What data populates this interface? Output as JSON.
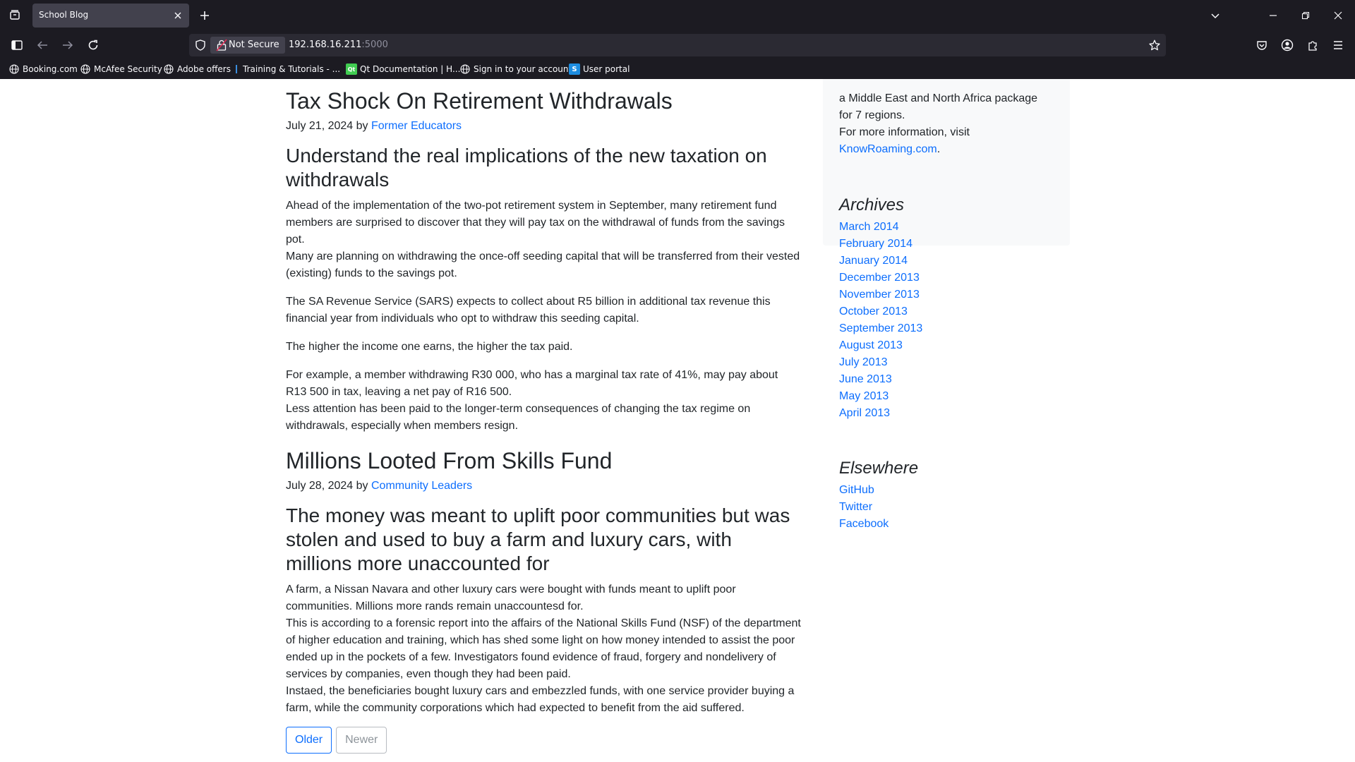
{
  "browser": {
    "tab_title": "School Blog",
    "not_secure_label": "Not Secure",
    "url_host": "192.168.16.211",
    "url_port": ":5000",
    "bookmarks": [
      {
        "label": "Booking.com",
        "icon": "globe-icon"
      },
      {
        "label": "McAfee Security",
        "icon": "globe-icon"
      },
      {
        "label": "Adobe offers",
        "icon": "globe-icon"
      },
      {
        "label": "Training & Tutorials - ...",
        "icon": "training-icon"
      },
      {
        "label": "Qt Documentation | H...",
        "icon": "qt-icon"
      },
      {
        "label": "Sign in to your account",
        "icon": "globe-icon"
      },
      {
        "label": "User portal",
        "icon": "s-icon"
      }
    ],
    "qt_badge": "Qt",
    "s_badge": "S"
  },
  "posts": [
    {
      "title": "Tax Shock On Retirement Withdrawals",
      "date": "July 21, 2024",
      "by": "by",
      "author": "Former Educators",
      "subtitle": "Understand the real implications of the new taxation on withdrawals",
      "paragraphs": [
        "Ahead of the implementation of the two-pot retirement system in September, many retirement fund members are surprised to discover that they will pay tax on the withdrawal of funds from the savings pot.",
        "Many are planning on withdrawing the once-off seeding capital that will be transferred from their vested (existing) funds to the savings pot.",
        "The SA Revenue Service (SARS) expects to collect about R5 billion in additional tax revenue this financial year from individuals who opt to withdraw this seeding capital.",
        "The higher the income one earns, the higher the tax paid.",
        "For example, a member withdrawing R30 000, who has a marginal tax rate of 41%, may pay about R13 500 in tax, leaving a net pay of R16 500.",
        "Less attention has been paid to the longer-term consequences of changing the tax regime on withdrawals, especially when members resign."
      ]
    },
    {
      "title": "Millions Looted From Skills Fund",
      "date": "July 28, 2024",
      "by": "by",
      "author": "Community Leaders",
      "subtitle": "The money was meant to uplift poor communities but was stolen and used to buy a farm and luxury cars, with millions more unaccounted for",
      "paragraphs": [
        "A farm, a Nissan Navara and other luxury cars were bought with funds meant to uplift poor communities. Millions more rands remain unaccountesd for.",
        "This is according to a forensic report into the affairs of the National Skills Fund (NSF) of the department of higher education and training, which has shed some light on how money intended to assist the poor ended up in the pockets of a few. Investigators found evidence of fraud, forgery and nondelivery of services by companies, even though they had been paid.",
        "Instaed, the beneficiaries bought luxury cars and embezzled funds, with one service provider buying a farm, while the community corporations which had expected to benefit from the aid suffered."
      ]
    }
  ],
  "pager": {
    "older": "Older",
    "newer": "Newer"
  },
  "sidebar": {
    "about_line1": "a Middle East and North Africa package",
    "about_line2": "for 7 regions.",
    "about_line3": "For more information, visit",
    "about_link": "KnowRoaming.com",
    "about_period": ".",
    "archives_heading": "Archives",
    "archives": [
      "March 2014",
      "February 2014",
      "January 2014",
      "December 2013",
      "November 2013",
      "October 2013",
      "September 2013",
      "August 2013",
      "July 2013",
      "June 2013",
      "May 2013",
      "April 2013"
    ],
    "elsewhere_heading": "Elsewhere",
    "elsewhere": [
      "GitHub",
      "Twitter",
      "Facebook"
    ]
  }
}
